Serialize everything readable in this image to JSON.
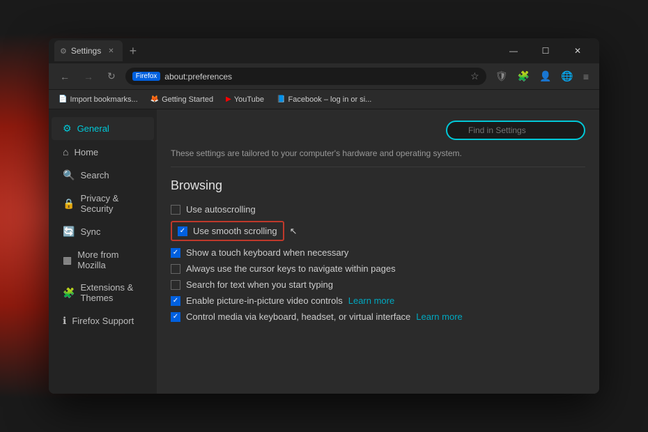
{
  "background": {
    "description": "colorful gradient background"
  },
  "browser": {
    "tab": {
      "icon": "⚙",
      "label": "Settings",
      "close": "✕"
    },
    "new_tab_btn": "+",
    "window_controls": {
      "minimize": "—",
      "maximize": "☐",
      "close": "✕"
    },
    "nav": {
      "back": "←",
      "forward": "→",
      "refresh": "↻",
      "firefox_badge": "Firefox",
      "url": "about:preferences",
      "star": "☆",
      "shield_icon": "🛡",
      "extensions_icon": "🧩",
      "account_icon": "👤",
      "theme_icon": "🌐",
      "menu_icon": "≡"
    },
    "bookmarks": [
      {
        "icon": "📄",
        "label": "Import bookmarks..."
      },
      {
        "icon": "🦊",
        "label": "Getting Started"
      },
      {
        "icon": "▶",
        "label": "YouTube"
      },
      {
        "icon": "📘",
        "label": "Facebook – log in or si..."
      }
    ]
  },
  "sidebar": {
    "items": [
      {
        "id": "general",
        "icon": "⚙",
        "label": "General",
        "active": true
      },
      {
        "id": "home",
        "icon": "⌂",
        "label": "Home",
        "active": false
      },
      {
        "id": "search",
        "icon": "🔍",
        "label": "Search",
        "active": false
      },
      {
        "id": "privacy",
        "icon": "🔒",
        "label": "Privacy & Security",
        "active": false
      },
      {
        "id": "sync",
        "icon": "🔄",
        "label": "Sync",
        "active": false
      },
      {
        "id": "mozilla",
        "icon": "▦",
        "label": "More from Mozilla",
        "active": false
      },
      {
        "id": "extensions",
        "icon": "🧩",
        "label": "Extensions & Themes",
        "active": false
      },
      {
        "id": "support",
        "icon": "ℹ",
        "label": "Firefox Support",
        "active": false
      }
    ]
  },
  "content": {
    "find_placeholder": "Find in Settings",
    "settings_desc": "These settings are tailored to your computer's hardware and operating system.",
    "browsing_section": "Browsing",
    "checkboxes": [
      {
        "id": "autoscroll",
        "checked": false,
        "label": "Use autoscrolling"
      },
      {
        "id": "smooth_scroll",
        "checked": true,
        "label": "Use smooth scrolling",
        "highlighted": true
      },
      {
        "id": "touch_keyboard",
        "checked": true,
        "label": "Show a touch keyboard when necessary"
      },
      {
        "id": "cursor_keys",
        "checked": false,
        "label": "Always use the cursor keys to navigate within pages"
      },
      {
        "id": "search_text",
        "checked": false,
        "label": "Search for text when you start typing"
      },
      {
        "id": "pip",
        "checked": true,
        "label": "Enable picture-in-picture video controls",
        "learn_more": "Learn more"
      },
      {
        "id": "media",
        "checked": true,
        "label": "Control media via keyboard, headset, or virtual interface",
        "learn_more": "Learn more"
      }
    ]
  }
}
